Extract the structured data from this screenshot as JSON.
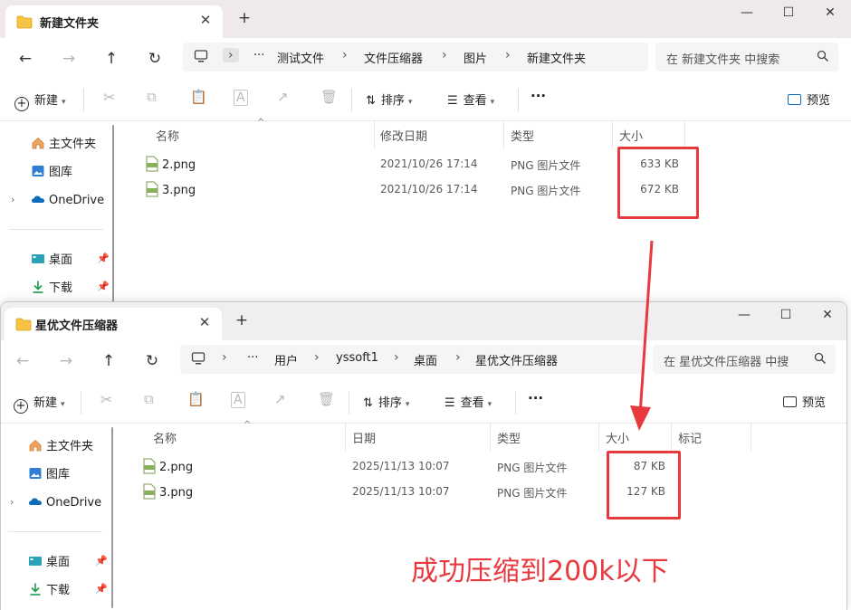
{
  "windows": [
    {
      "tab_title": "新建文件夹",
      "breadcrumbs": [
        "测试文件",
        "文件压缩器",
        "图片",
        "新建文件夹"
      ],
      "search_placeholder": "在 新建文件夹 中搜索",
      "columns": {
        "name": "名称",
        "date": "修改日期",
        "type": "类型",
        "size": "大小"
      },
      "files": [
        {
          "name": "2.png",
          "date": "2021/10/26 17:14",
          "type": "PNG 图片文件",
          "size": "633 KB"
        },
        {
          "name": "3.png",
          "date": "2021/10/26 17:14",
          "type": "PNG 图片文件",
          "size": "672 KB"
        }
      ]
    },
    {
      "tab_title": "星优文件压缩器",
      "breadcrumbs": [
        "用户",
        "yssoft1",
        "桌面",
        "星优文件压缩器"
      ],
      "search_placeholder": "在 星优文件压缩器 中搜",
      "columns": {
        "name": "名称",
        "date": "日期",
        "type": "类型",
        "size": "大小",
        "tag": "标记"
      },
      "files": [
        {
          "name": "2.png",
          "date": "2025/11/13 10:07",
          "type": "PNG 图片文件",
          "size": "87 KB"
        },
        {
          "name": "3.png",
          "date": "2025/11/13 10:07",
          "type": "PNG 图片文件",
          "size": "127 KB"
        }
      ]
    }
  ],
  "toolbar": {
    "new": "新建",
    "sort": "排序",
    "view": "查看",
    "more": "···",
    "preview": "预览"
  },
  "nav": {
    "home": "主文件夹",
    "gallery": "图库",
    "onedrive": "OneDrive",
    "desktop": "桌面",
    "downloads": "下载"
  },
  "address": {
    "more": "···"
  },
  "annotation": "成功压缩到200k以下",
  "colors": {
    "highlight": "#e8393f",
    "folder": "#f6c343",
    "onedrive": "#0f6cbd"
  }
}
